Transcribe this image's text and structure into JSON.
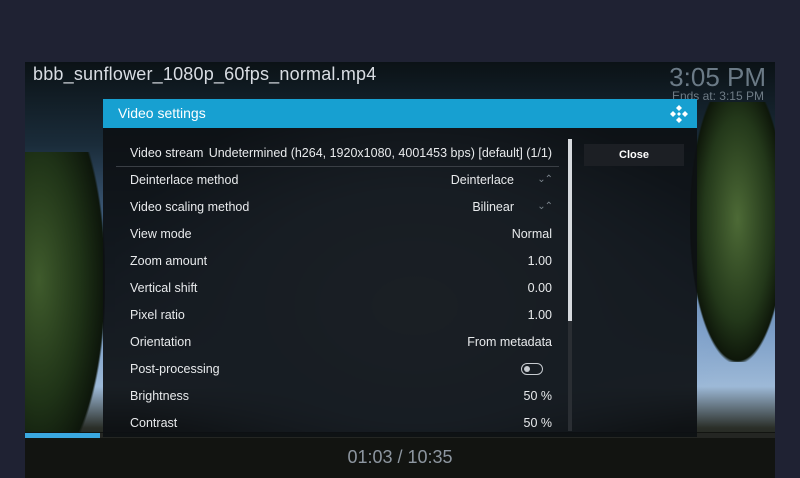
{
  "player": {
    "file_title": "bbb_sunflower_1080p_60fps_normal.mp4",
    "clock": "3:05 PM",
    "ends_at": "Ends at: 3:15 PM",
    "time_readout": "01:03 / 10:35",
    "progress_fraction": 0.1,
    "accent_color": "#3aa8e0"
  },
  "dialog": {
    "title": "Video settings",
    "header_color": "#17a0d1",
    "logo_icon": "kodi-logo-icon",
    "close_label": "Close",
    "rows": [
      {
        "label": "Video stream",
        "value": "Undetermined (h264, 1920x1080, 4001453 bps) [default] (1/1)"
      },
      {
        "label": "Deinterlace method",
        "value": "Deinterlace",
        "arrows": "⌄⌃"
      },
      {
        "label": "Video scaling method",
        "value": "Bilinear",
        "arrows": "⌄⌃"
      },
      {
        "label": "View mode",
        "value": "Normal"
      },
      {
        "label": "Zoom amount",
        "value": "1.00"
      },
      {
        "label": "Vertical shift",
        "value": "0.00"
      },
      {
        "label": "Pixel ratio",
        "value": "1.00"
      },
      {
        "label": "Orientation",
        "value": "From metadata"
      },
      {
        "label": "Post-processing",
        "toggle": "off"
      },
      {
        "label": "Brightness",
        "value": "50 %"
      },
      {
        "label": "Contrast",
        "value": "50 %"
      }
    ]
  }
}
